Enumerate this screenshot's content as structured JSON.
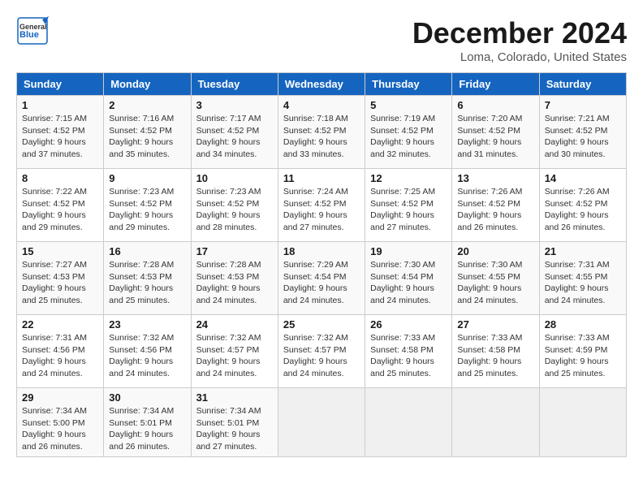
{
  "header": {
    "logo_general": "General",
    "logo_blue": "Blue",
    "month_title": "December 2024",
    "location": "Loma, Colorado, United States"
  },
  "days_of_week": [
    "Sunday",
    "Monday",
    "Tuesday",
    "Wednesday",
    "Thursday",
    "Friday",
    "Saturday"
  ],
  "weeks": [
    [
      {
        "day": "1",
        "sunrise": "Sunrise: 7:15 AM",
        "sunset": "Sunset: 4:52 PM",
        "daylight": "Daylight: 9 hours and 37 minutes."
      },
      {
        "day": "2",
        "sunrise": "Sunrise: 7:16 AM",
        "sunset": "Sunset: 4:52 PM",
        "daylight": "Daylight: 9 hours and 35 minutes."
      },
      {
        "day": "3",
        "sunrise": "Sunrise: 7:17 AM",
        "sunset": "Sunset: 4:52 PM",
        "daylight": "Daylight: 9 hours and 34 minutes."
      },
      {
        "day": "4",
        "sunrise": "Sunrise: 7:18 AM",
        "sunset": "Sunset: 4:52 PM",
        "daylight": "Daylight: 9 hours and 33 minutes."
      },
      {
        "day": "5",
        "sunrise": "Sunrise: 7:19 AM",
        "sunset": "Sunset: 4:52 PM",
        "daylight": "Daylight: 9 hours and 32 minutes."
      },
      {
        "day": "6",
        "sunrise": "Sunrise: 7:20 AM",
        "sunset": "Sunset: 4:52 PM",
        "daylight": "Daylight: 9 hours and 31 minutes."
      },
      {
        "day": "7",
        "sunrise": "Sunrise: 7:21 AM",
        "sunset": "Sunset: 4:52 PM",
        "daylight": "Daylight: 9 hours and 30 minutes."
      }
    ],
    [
      {
        "day": "8",
        "sunrise": "Sunrise: 7:22 AM",
        "sunset": "Sunset: 4:52 PM",
        "daylight": "Daylight: 9 hours and 29 minutes."
      },
      {
        "day": "9",
        "sunrise": "Sunrise: 7:23 AM",
        "sunset": "Sunset: 4:52 PM",
        "daylight": "Daylight: 9 hours and 29 minutes."
      },
      {
        "day": "10",
        "sunrise": "Sunrise: 7:23 AM",
        "sunset": "Sunset: 4:52 PM",
        "daylight": "Daylight: 9 hours and 28 minutes."
      },
      {
        "day": "11",
        "sunrise": "Sunrise: 7:24 AM",
        "sunset": "Sunset: 4:52 PM",
        "daylight": "Daylight: 9 hours and 27 minutes."
      },
      {
        "day": "12",
        "sunrise": "Sunrise: 7:25 AM",
        "sunset": "Sunset: 4:52 PM",
        "daylight": "Daylight: 9 hours and 27 minutes."
      },
      {
        "day": "13",
        "sunrise": "Sunrise: 7:26 AM",
        "sunset": "Sunset: 4:52 PM",
        "daylight": "Daylight: 9 hours and 26 minutes."
      },
      {
        "day": "14",
        "sunrise": "Sunrise: 7:26 AM",
        "sunset": "Sunset: 4:52 PM",
        "daylight": "Daylight: 9 hours and 26 minutes."
      }
    ],
    [
      {
        "day": "15",
        "sunrise": "Sunrise: 7:27 AM",
        "sunset": "Sunset: 4:53 PM",
        "daylight": "Daylight: 9 hours and 25 minutes."
      },
      {
        "day": "16",
        "sunrise": "Sunrise: 7:28 AM",
        "sunset": "Sunset: 4:53 PM",
        "daylight": "Daylight: 9 hours and 25 minutes."
      },
      {
        "day": "17",
        "sunrise": "Sunrise: 7:28 AM",
        "sunset": "Sunset: 4:53 PM",
        "daylight": "Daylight: 9 hours and 24 minutes."
      },
      {
        "day": "18",
        "sunrise": "Sunrise: 7:29 AM",
        "sunset": "Sunset: 4:54 PM",
        "daylight": "Daylight: 9 hours and 24 minutes."
      },
      {
        "day": "19",
        "sunrise": "Sunrise: 7:30 AM",
        "sunset": "Sunset: 4:54 PM",
        "daylight": "Daylight: 9 hours and 24 minutes."
      },
      {
        "day": "20",
        "sunrise": "Sunrise: 7:30 AM",
        "sunset": "Sunset: 4:55 PM",
        "daylight": "Daylight: 9 hours and 24 minutes."
      },
      {
        "day": "21",
        "sunrise": "Sunrise: 7:31 AM",
        "sunset": "Sunset: 4:55 PM",
        "daylight": "Daylight: 9 hours and 24 minutes."
      }
    ],
    [
      {
        "day": "22",
        "sunrise": "Sunrise: 7:31 AM",
        "sunset": "Sunset: 4:56 PM",
        "daylight": "Daylight: 9 hours and 24 minutes."
      },
      {
        "day": "23",
        "sunrise": "Sunrise: 7:32 AM",
        "sunset": "Sunset: 4:56 PM",
        "daylight": "Daylight: 9 hours and 24 minutes."
      },
      {
        "day": "24",
        "sunrise": "Sunrise: 7:32 AM",
        "sunset": "Sunset: 4:57 PM",
        "daylight": "Daylight: 9 hours and 24 minutes."
      },
      {
        "day": "25",
        "sunrise": "Sunrise: 7:32 AM",
        "sunset": "Sunset: 4:57 PM",
        "daylight": "Daylight: 9 hours and 24 minutes."
      },
      {
        "day": "26",
        "sunrise": "Sunrise: 7:33 AM",
        "sunset": "Sunset: 4:58 PM",
        "daylight": "Daylight: 9 hours and 25 minutes."
      },
      {
        "day": "27",
        "sunrise": "Sunrise: 7:33 AM",
        "sunset": "Sunset: 4:58 PM",
        "daylight": "Daylight: 9 hours and 25 minutes."
      },
      {
        "day": "28",
        "sunrise": "Sunrise: 7:33 AM",
        "sunset": "Sunset: 4:59 PM",
        "daylight": "Daylight: 9 hours and 25 minutes."
      }
    ],
    [
      {
        "day": "29",
        "sunrise": "Sunrise: 7:34 AM",
        "sunset": "Sunset: 5:00 PM",
        "daylight": "Daylight: 9 hours and 26 minutes."
      },
      {
        "day": "30",
        "sunrise": "Sunrise: 7:34 AM",
        "sunset": "Sunset: 5:01 PM",
        "daylight": "Daylight: 9 hours and 26 minutes."
      },
      {
        "day": "31",
        "sunrise": "Sunrise: 7:34 AM",
        "sunset": "Sunset: 5:01 PM",
        "daylight": "Daylight: 9 hours and 27 minutes."
      },
      null,
      null,
      null,
      null
    ]
  ]
}
